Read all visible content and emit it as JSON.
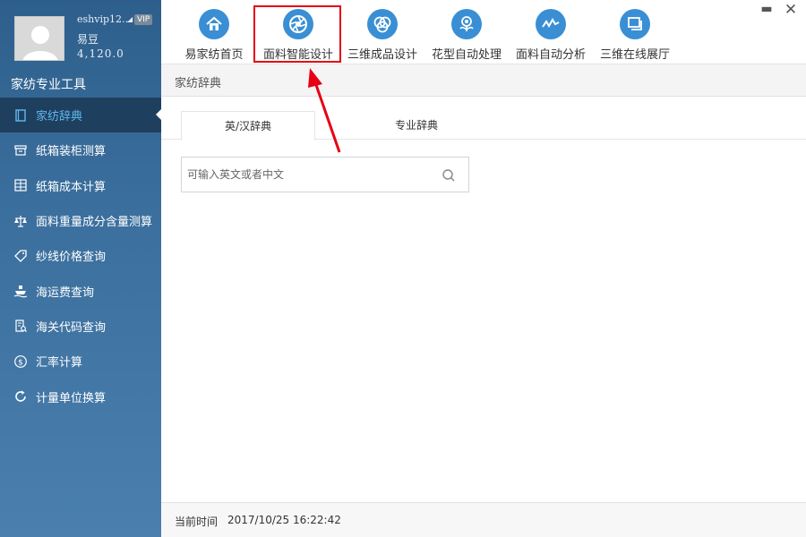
{
  "profile": {
    "username": "eshvip12…",
    "vip": "VIP",
    "points_label": "易豆",
    "points_value": "4,120.0"
  },
  "sidebar": {
    "title": "家纺专业工具",
    "items": [
      {
        "label": "家纺辞典",
        "icon": "book-icon",
        "active": true
      },
      {
        "label": "纸箱装柜测算",
        "icon": "box-icon"
      },
      {
        "label": "纸箱成本计算",
        "icon": "grid-icon"
      },
      {
        "label": "面料重量成分含量测算",
        "icon": "scale-icon"
      },
      {
        "label": "纱线价格查询",
        "icon": "tag-icon"
      },
      {
        "label": "海运费查询",
        "icon": "ship-icon"
      },
      {
        "label": "海关代码查询",
        "icon": "document-search-icon"
      },
      {
        "label": "汇率计算",
        "icon": "dollar-icon"
      },
      {
        "label": "计量单位换算",
        "icon": "refresh-icon"
      }
    ]
  },
  "toolbar": {
    "items": [
      {
        "label": "易家纺首页",
        "icon": "home-icon"
      },
      {
        "label": "面料智能设计",
        "icon": "aperture-icon"
      },
      {
        "label": "三维成品设计",
        "icon": "rings-icon"
      },
      {
        "label": "花型自动处理",
        "icon": "flower-icon"
      },
      {
        "label": "面料自动分析",
        "icon": "wave-icon"
      },
      {
        "label": "三维在线展厅",
        "icon": "gallery-icon"
      }
    ]
  },
  "section": {
    "title": "家纺辞典"
  },
  "tabs": [
    {
      "label": "英/汉辞典",
      "active": true
    },
    {
      "label": "专业辞典"
    }
  ],
  "search": {
    "placeholder": "可输入英文或者中文",
    "value": ""
  },
  "footer": {
    "label": "当前时间",
    "time": "2017/10/25 16:22:42"
  },
  "colors": {
    "accent": "#3a8fd4",
    "highlight": "#e60012",
    "active_text": "#5fb8f0"
  }
}
